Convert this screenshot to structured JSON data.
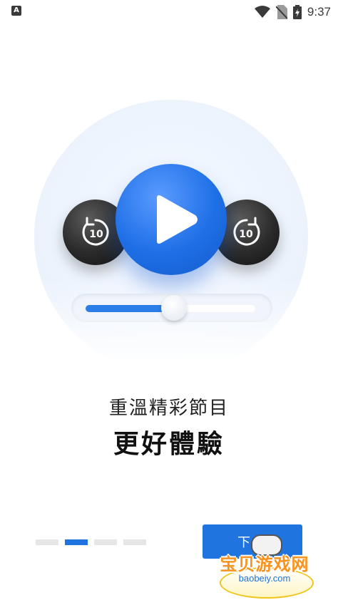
{
  "status_bar": {
    "app_icon_letter": "A",
    "time": "9:37"
  },
  "slider": {
    "progress": 0.52
  },
  "onboarding": {
    "subtitle": "重溫精彩節目",
    "title": "更好體驗",
    "page_indicator": {
      "total": 4,
      "current": 2
    },
    "next_button_label": "下一"
  },
  "player_icons": {
    "skip_back_label": "10",
    "skip_forward_label": "10"
  },
  "watermark": {
    "brand": "宝贝游戏网",
    "url": "baobeiy.com"
  },
  "colors": {
    "accent": "#1f74e0",
    "watermark_orange": "#f7931e"
  }
}
